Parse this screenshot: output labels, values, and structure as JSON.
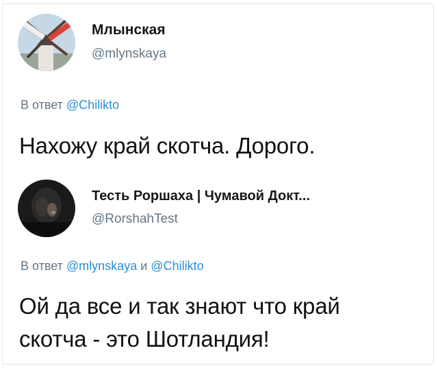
{
  "tweets": [
    {
      "author_name": "Млынская",
      "author_handle": "@mlynskaya",
      "reply_prefix": "В ответ",
      "reply_mentions": [
        "@Chilikto"
      ],
      "reply_joiner": "",
      "text": "Нахожу край скотча. Дорого."
    },
    {
      "author_name": "Тесть Роршаха | Чумавой Докт...",
      "author_handle": "@RorshahTest",
      "reply_prefix": "В ответ",
      "reply_mentions": [
        "@mlynskaya",
        "@Chilikto"
      ],
      "reply_joiner": "и",
      "text_line1": "Ой да все и так знают что край",
      "text_line2": "скотча - это Шотландия!"
    }
  ],
  "colors": {
    "name": "#14171a",
    "handle": "#657786",
    "mention": "#2b8ed6",
    "text": "#111111"
  }
}
